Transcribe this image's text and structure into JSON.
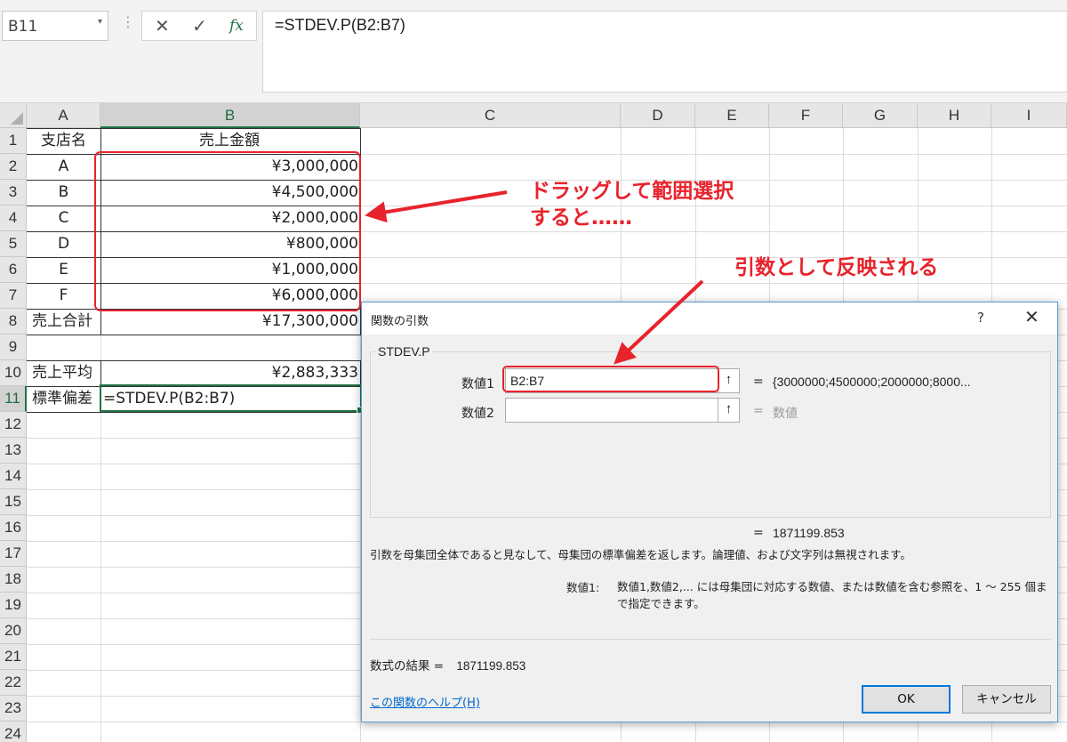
{
  "formula_bar": {
    "name_box": "B11",
    "formula": "=STDEV.P(B2:B7)",
    "cancel_icon": "✕",
    "enter_icon": "✓",
    "function_icon": "fx"
  },
  "columns": [
    "A",
    "B",
    "C",
    "D",
    "E",
    "F",
    "G",
    "H",
    "I"
  ],
  "rows": [
    "1",
    "2",
    "3",
    "4",
    "5",
    "6",
    "7",
    "8",
    "9",
    "10",
    "11",
    "12",
    "13",
    "14",
    "15",
    "16",
    "17",
    "18",
    "19",
    "20",
    "21",
    "22",
    "23",
    "24"
  ],
  "sheet": {
    "header": {
      "a": "支店名",
      "b": "売上金額"
    },
    "data_rows": [
      {
        "a": "A",
        "b": "¥3,000,000"
      },
      {
        "a": "B",
        "b": "¥4,500,000"
      },
      {
        "a": "C",
        "b": "¥2,000,000"
      },
      {
        "a": "D",
        "b": "¥800,000"
      },
      {
        "a": "E",
        "b": "¥1,000,000"
      },
      {
        "a": "F",
        "b": "¥6,000,000"
      }
    ],
    "total": {
      "a": "売上合計",
      "b": "¥17,300,000"
    },
    "average": {
      "a": "売上平均",
      "b": "¥2,883,333"
    },
    "stdev": {
      "a": "標準偏差",
      "b": "=STDEV.P(B2:B7)"
    }
  },
  "annotations": {
    "drag_line1": "ドラッグして範囲選択",
    "drag_line2": "すると……",
    "reflect": "引数として反映される",
    "color": "#e8232c"
  },
  "dialog": {
    "title": "関数の引数",
    "help_glyph": "?",
    "close_glyph": "✕",
    "function_name": "STDEV.P",
    "arg1_label": "数値1",
    "arg1_value": "B2:B7",
    "arg1_result": "{3000000;4500000;2000000;8000...",
    "arg2_label": "数値2",
    "arg2_value": "",
    "arg2_result": "数値",
    "equals": "=",
    "pick_glyph": "↑",
    "function_result": "1871199.853",
    "description": "引数を母集団全体であると見なして、母集団の標準偏差を返します。論理値、および文字列は無視されます。",
    "arg_desc_label": "数値1:",
    "arg_desc_text": "数値1,数値2,... には母集団に対応する数値、または数値を含む参照を、1 ～ 255 個まで指定できます。",
    "formula_result_label": "数式の結果 =",
    "formula_result_value": "1871199.853",
    "help_link": "この関数のヘルプ(H)",
    "ok": "OK",
    "cancel": "キャンセル"
  }
}
